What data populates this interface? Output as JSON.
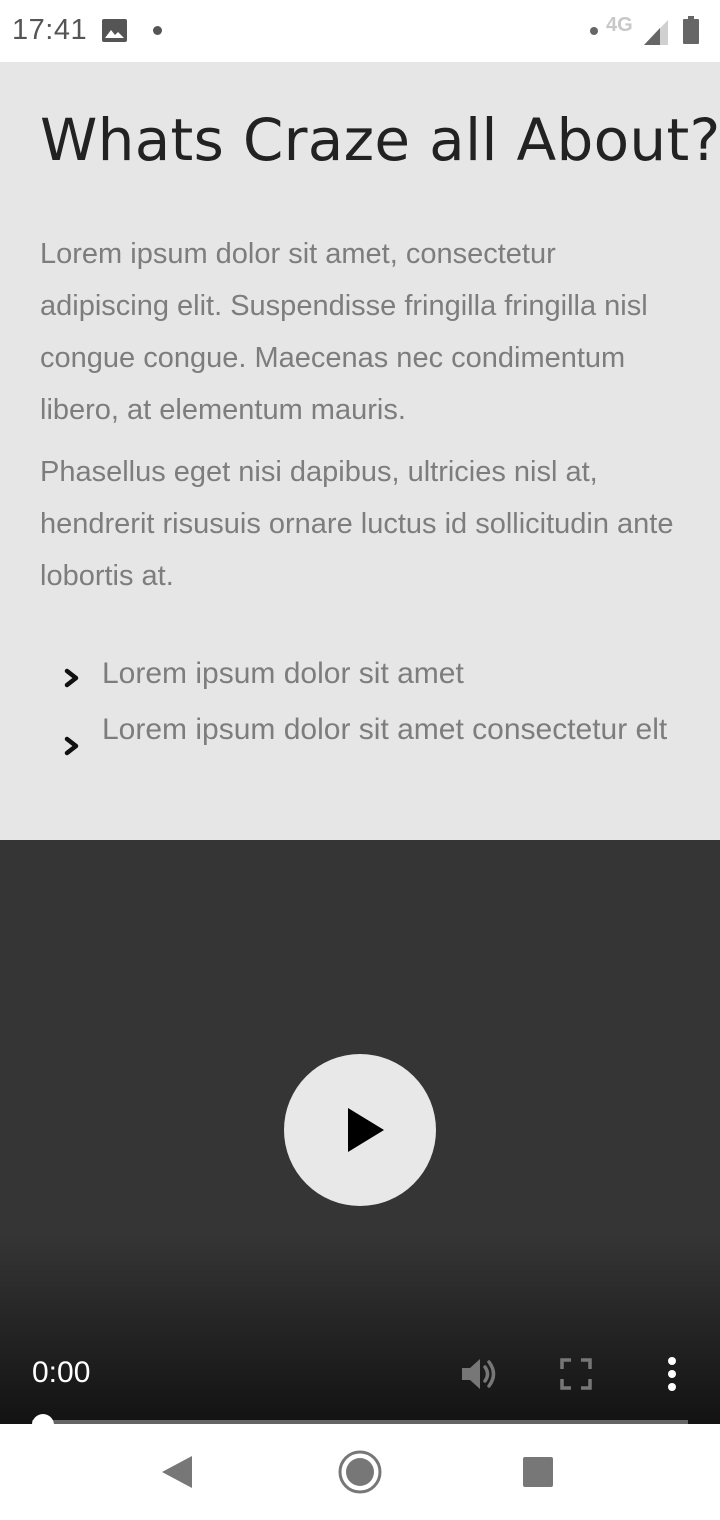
{
  "status_bar": {
    "time": "17:41",
    "network": "4G",
    "icons": [
      "image-icon",
      "notification-dot",
      "signal-icon",
      "battery-icon"
    ]
  },
  "content": {
    "title": "Whats Craze all About?",
    "paragraphs": [
      "Lorem ipsum dolor sit amet, consectetur adipiscing elit. Suspendisse fringilla fringilla nisl congue congue. Maecenas nec condimentum libero, at elementum mauris.",
      "Phasellus eget nisi dapibus, ultricies nisl at, hendrerit risusuis ornare luctus id sollicitudin ante lobortis at."
    ],
    "list_items": [
      "Lorem ipsum dolor sit amet",
      "Lorem ipsum dolor sit amet consectetur elt"
    ]
  },
  "video": {
    "current_time": "0:00",
    "progress": 0,
    "controls": [
      "play-icon",
      "volume-icon",
      "fullscreen-icon",
      "more-icon"
    ]
  },
  "nav_bar": {
    "buttons": [
      "back-icon",
      "home-icon",
      "recents-icon"
    ]
  },
  "colors": {
    "content_bg": "#e6e6e6",
    "title_text": "#222222",
    "body_text": "#7d7d7d",
    "video_bg": "#353535",
    "play_button": "#e8e8e8"
  }
}
